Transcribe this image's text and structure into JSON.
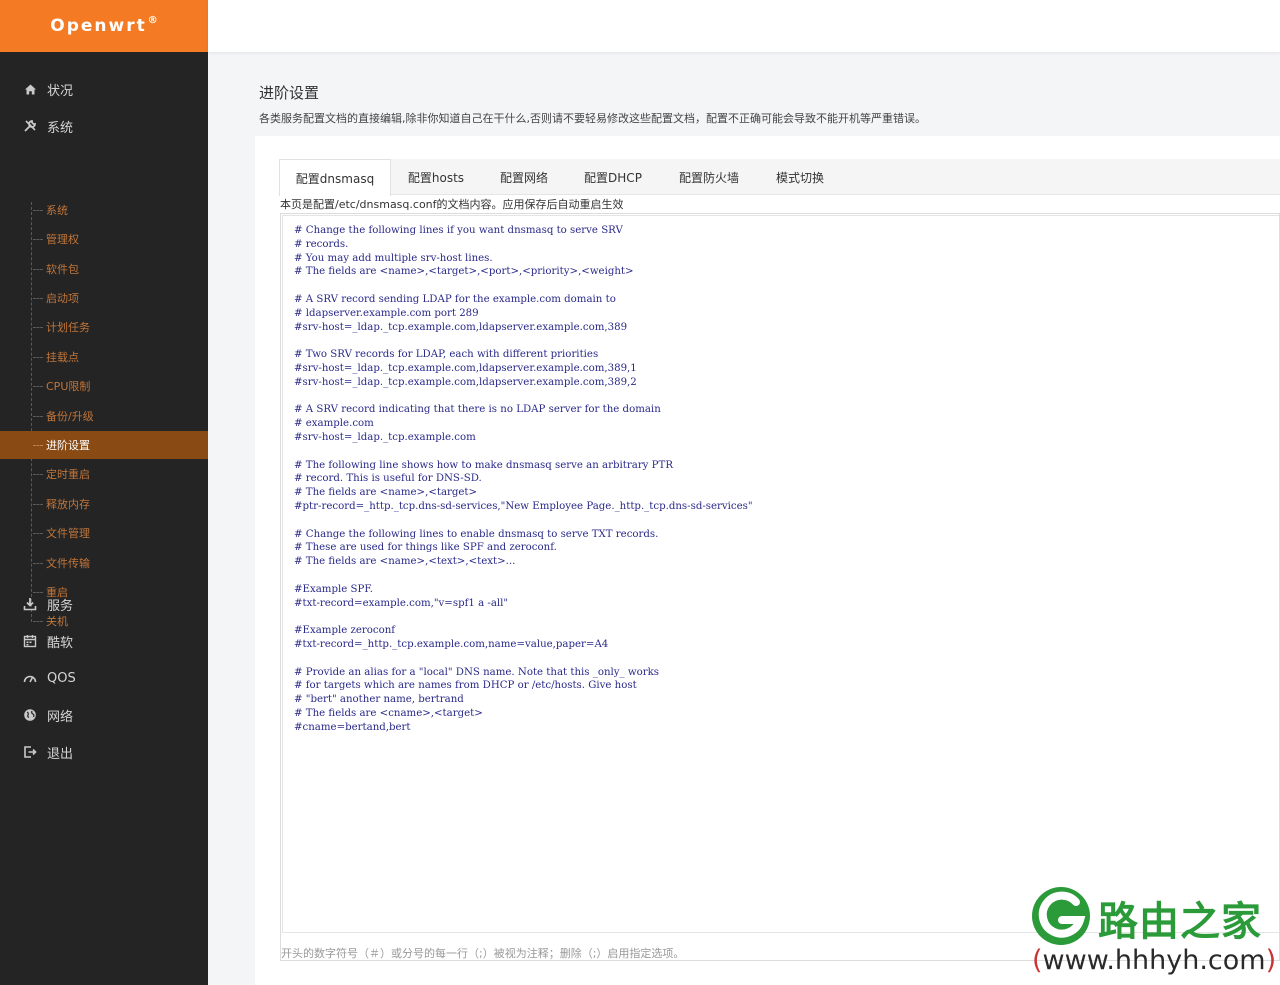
{
  "brand": {
    "name": "Openwrt",
    "mark": "®"
  },
  "sidebar": {
    "main": [
      {
        "label": "状况",
        "icon": "home-icon"
      },
      {
        "label": "系统",
        "icon": "tools-icon"
      },
      {
        "label": "服务",
        "icon": "download-icon"
      },
      {
        "label": "酷软",
        "icon": "calendar-icon"
      },
      {
        "label": "QOS",
        "icon": "gauge-icon"
      },
      {
        "label": "网络",
        "icon": "globe-icon"
      },
      {
        "label": "退出",
        "icon": "logout-icon"
      }
    ],
    "sub": [
      {
        "label": "系统"
      },
      {
        "label": "管理权"
      },
      {
        "label": "软件包"
      },
      {
        "label": "启动项"
      },
      {
        "label": "计划任务"
      },
      {
        "label": "挂载点"
      },
      {
        "label": "CPU限制"
      },
      {
        "label": "备份/升级"
      },
      {
        "label": "进阶设置",
        "active": true
      },
      {
        "label": "定时重启"
      },
      {
        "label": "释放内存"
      },
      {
        "label": "文件管理"
      },
      {
        "label": "文件传输"
      },
      {
        "label": "重启"
      },
      {
        "label": "关机"
      }
    ]
  },
  "page": {
    "title": "进阶设置",
    "description": "各类服务配置文档的直接编辑,除非你知道自己在干什么,否则请不要轻易修改这些配置文档，配置不正确可能会导致不能开机等严重错误。"
  },
  "tabs": [
    {
      "label": "配置dnsmasq",
      "active": true
    },
    {
      "label": "配置hosts"
    },
    {
      "label": "配置网络"
    },
    {
      "label": "配置DHCP"
    },
    {
      "label": "配置防火墙"
    },
    {
      "label": "模式切换"
    }
  ],
  "file_note": "本页是配置/etc/dnsmasq.conf的文档内容。应用保存后自动重启生效",
  "code_lines": [
    "# Change the following lines if you want dnsmasq to serve SRV",
    "# records.",
    "# You may add multiple srv-host lines.",
    "# The fields are <name>,<target>,<port>,<priority>,<weight>",
    "",
    "# A SRV record sending LDAP for the example.com domain to",
    "# ldapserver.example.com port 289",
    "#srv-host=_ldap._tcp.example.com,ldapserver.example.com,389",
    "",
    "# Two SRV records for LDAP, each with different priorities",
    "#srv-host=_ldap._tcp.example.com,ldapserver.example.com,389,1",
    "#srv-host=_ldap._tcp.example.com,ldapserver.example.com,389,2",
    "",
    "# A SRV record indicating that there is no LDAP server for the domain",
    "# example.com",
    "#srv-host=_ldap._tcp.example.com",
    "",
    "# The following line shows how to make dnsmasq serve an arbitrary PTR",
    "# record. This is useful for DNS-SD.",
    "# The fields are <name>,<target>",
    "#ptr-record=_http._tcp.dns-sd-services,\"New Employee Page._http._tcp.dns-sd-services\"",
    "",
    "# Change the following lines to enable dnsmasq to serve TXT records.",
    "# These are used for things like SPF and zeroconf.",
    "# The fields are <name>,<text>,<text>...",
    "",
    "#Example SPF.",
    "#txt-record=example.com,\"v=spf1 a -all\"",
    "",
    "#Example zeroconf",
    "#txt-record=_http._tcp.example.com,name=value,paper=A4",
    "",
    "# Provide an alias for a \"local\" DNS name. Note that this _only_ works",
    "# for targets which are names from DHCP or /etc/hosts. Give host",
    "# \"bert\" another name, bertrand",
    "# The fields are <cname>,<target>",
    "#cname=bertand,bert"
  ],
  "hint": "开头的数字符号（＃）或分号的每一行（;）被视为注释；删除（;）启用指定选项。",
  "watermark": {
    "name": "路由之家",
    "url": "www.hhhyh.com",
    "open": "(",
    "close": ")"
  },
  "colors": {
    "brand": "#f47b23",
    "sidebar": "#242424",
    "active_item": "#8a4a14",
    "code": "#2a2a8a",
    "watermark_green": "#2b9a39"
  }
}
